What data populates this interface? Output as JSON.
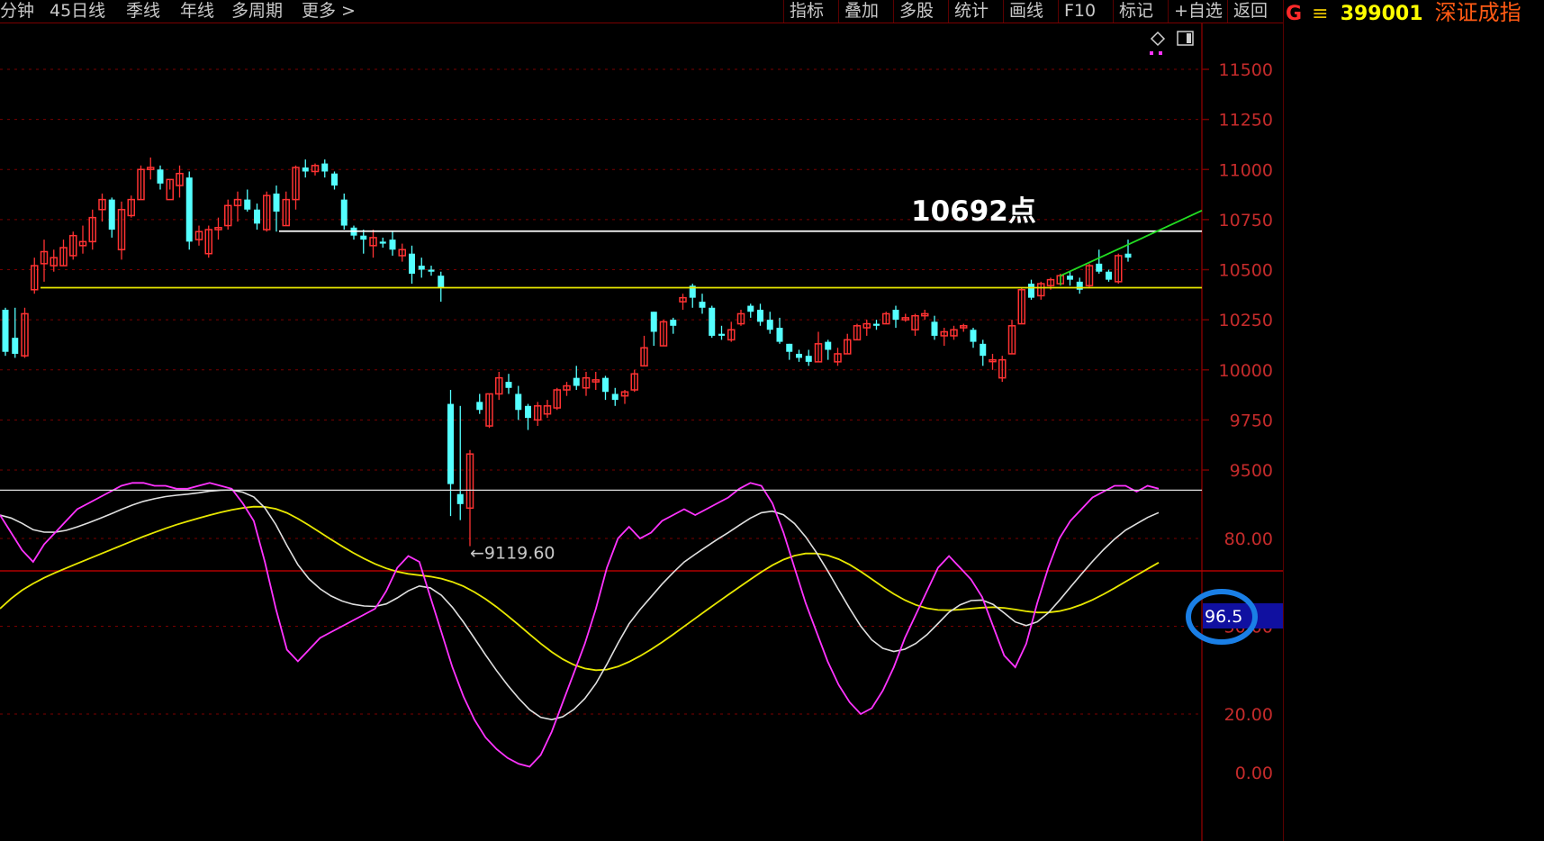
{
  "toolbar": {
    "left_items": [
      "分钟",
      "45日线",
      "季线",
      "年线",
      "多周期",
      "更多 >"
    ],
    "right_items": [
      "指标",
      "叠加",
      "多股",
      "统计",
      "画线",
      "F10",
      "标记",
      "+自选",
      "返回"
    ]
  },
  "stock": {
    "market_flag": "G",
    "menu_glyph": "≡",
    "code": "399001",
    "name": "深证成指"
  },
  "colors": {
    "up": "#ff3232",
    "down": "#54ffff",
    "grid": "#7a0000",
    "axis_text": "#c52b2b",
    "support_line": "#e8e800",
    "resistance_line": "#ffffff",
    "trend_line": "#22dd22",
    "osc_k": "#ff33ff",
    "osc_d": "#e0e0e0",
    "osc_j": "#e8e800",
    "highlight": "#1a7fe6"
  },
  "main_chart": {
    "y_ticks": [
      "11500",
      "11250",
      "11000",
      "10750",
      "10500",
      "10250",
      "10000",
      "9750",
      "9500"
    ],
    "resistance_label": "10692点",
    "low_label": "←9119.60",
    "resistance_value": 10692,
    "support_value": 10410,
    "low_value": 9119.6,
    "candles": [
      [
        10300,
        10310,
        10070,
        10090
      ],
      [
        10160,
        10310,
        10060,
        10080
      ],
      [
        10070,
        10310,
        10060,
        10280
      ],
      [
        10400,
        10560,
        10380,
        10520
      ],
      [
        10530,
        10650,
        10440,
        10590
      ],
      [
        10520,
        10600,
        10490,
        10560
      ],
      [
        10520,
        10650,
        10520,
        10610
      ],
      [
        10570,
        10690,
        10550,
        10670
      ],
      [
        10620,
        10720,
        10580,
        10640
      ],
      [
        10640,
        10800,
        10600,
        10760
      ],
      [
        10800,
        10880,
        10740,
        10850
      ],
      [
        10850,
        10860,
        10660,
        10700
      ],
      [
        10600,
        10840,
        10550,
        10800
      ],
      [
        10770,
        10870,
        10760,
        10850
      ],
      [
        10850,
        11020,
        10850,
        11000
      ],
      [
        11000,
        11060,
        10950,
        11010
      ],
      [
        11000,
        11020,
        10900,
        10930
      ],
      [
        10850,
        10950,
        10900,
        10950
      ],
      [
        10920,
        11020,
        10860,
        10980
      ],
      [
        10960,
        10990,
        10600,
        10640
      ],
      [
        10650,
        10720,
        10620,
        10690
      ],
      [
        10580,
        10720,
        10560,
        10700
      ],
      [
        10700,
        10760,
        10650,
        10710
      ],
      [
        10720,
        10850,
        10700,
        10820
      ],
      [
        10820,
        10890,
        10740,
        10850
      ],
      [
        10850,
        10900,
        10790,
        10800
      ],
      [
        10800,
        10830,
        10700,
        10730
      ],
      [
        10700,
        10890,
        10690,
        10870
      ],
      [
        10880,
        10920,
        10690,
        10790
      ],
      [
        10720,
        10890,
        10720,
        10850
      ],
      [
        10850,
        11020,
        10800,
        11010
      ],
      [
        11010,
        11050,
        10960,
        10990
      ],
      [
        10990,
        11030,
        10970,
        11020
      ],
      [
        11030,
        11050,
        10960,
        10990
      ],
      [
        10980,
        10990,
        10900,
        10920
      ],
      [
        10850,
        10880,
        10700,
        10720
      ],
      [
        10710,
        10720,
        10650,
        10670
      ],
      [
        10670,
        10700,
        10580,
        10650
      ],
      [
        10620,
        10700,
        10560,
        10660
      ],
      [
        10640,
        10660,
        10610,
        10630
      ],
      [
        10650,
        10690,
        10570,
        10600
      ],
      [
        10570,
        10630,
        10540,
        10600
      ],
      [
        10580,
        10620,
        10430,
        10480
      ],
      [
        10520,
        10560,
        10460,
        10500
      ],
      [
        10500,
        10520,
        10470,
        10490
      ],
      [
        10470,
        10490,
        10340,
        10410
      ],
      [
        9830,
        9900,
        9270,
        9430
      ],
      [
        9380,
        9820,
        9250,
        9330
      ],
      [
        9310,
        9600,
        9120,
        9580
      ],
      [
        9840,
        9880,
        9780,
        9800
      ],
      [
        9720,
        9880,
        9710,
        9880
      ],
      [
        9880,
        9990,
        9850,
        9960
      ],
      [
        9940,
        9980,
        9880,
        9910
      ],
      [
        9880,
        9920,
        9750,
        9800
      ],
      [
        9820,
        9830,
        9700,
        9760
      ],
      [
        9750,
        9840,
        9720,
        9820
      ],
      [
        9780,
        9850,
        9760,
        9820
      ],
      [
        9810,
        9910,
        9800,
        9900
      ],
      [
        9900,
        9940,
        9870,
        9920
      ],
      [
        9960,
        10020,
        9900,
        9920
      ],
      [
        9910,
        9990,
        9870,
        9960
      ],
      [
        9940,
        9990,
        9900,
        9950
      ],
      [
        9960,
        9970,
        9850,
        9890
      ],
      [
        9880,
        9910,
        9820,
        9850
      ],
      [
        9870,
        9900,
        9830,
        9890
      ],
      [
        9900,
        10000,
        9890,
        9980
      ],
      [
        10020,
        10170,
        10020,
        10110
      ],
      [
        10290,
        10290,
        10120,
        10190
      ],
      [
        10120,
        10250,
        10120,
        10240
      ],
      [
        10250,
        10260,
        10180,
        10220
      ],
      [
        10340,
        10380,
        10300,
        10360
      ],
      [
        10420,
        10430,
        10310,
        10360
      ],
      [
        10340,
        10380,
        10280,
        10310
      ],
      [
        10310,
        10320,
        10160,
        10170
      ],
      [
        10180,
        10220,
        10150,
        10170
      ],
      [
        10150,
        10240,
        10140,
        10200
      ],
      [
        10230,
        10300,
        10220,
        10280
      ],
      [
        10320,
        10330,
        10260,
        10290
      ],
      [
        10300,
        10330,
        10220,
        10240
      ],
      [
        10250,
        10290,
        10180,
        10200
      ],
      [
        10210,
        10260,
        10130,
        10140
      ],
      [
        10130,
        10130,
        10050,
        10090
      ],
      [
        10080,
        10100,
        10040,
        10060
      ],
      [
        10070,
        10100,
        10020,
        10040
      ],
      [
        10040,
        10190,
        10040,
        10130
      ],
      [
        10140,
        10150,
        10050,
        10100
      ],
      [
        10040,
        10110,
        10020,
        10080
      ],
      [
        10080,
        10180,
        10080,
        10150
      ],
      [
        10150,
        10230,
        10150,
        10220
      ],
      [
        10210,
        10250,
        10170,
        10230
      ],
      [
        10230,
        10250,
        10200,
        10220
      ],
      [
        10230,
        10290,
        10230,
        10280
      ],
      [
        10300,
        10320,
        10210,
        10250
      ],
      [
        10250,
        10280,
        10240,
        10260
      ],
      [
        10200,
        10280,
        10170,
        10270
      ],
      [
        10270,
        10300,
        10250,
        10280
      ],
      [
        10240,
        10270,
        10150,
        10170
      ],
      [
        10170,
        10210,
        10120,
        10190
      ],
      [
        10170,
        10220,
        10150,
        10200
      ],
      [
        10210,
        10230,
        10190,
        10220
      ],
      [
        10200,
        10210,
        10110,
        10140
      ],
      [
        10130,
        10150,
        10020,
        10070
      ],
      [
        10050,
        10080,
        10000,
        10050
      ],
      [
        9960,
        10070,
        9940,
        10050
      ],
      [
        10080,
        10250,
        10080,
        10220
      ],
      [
        10230,
        10410,
        10230,
        10400
      ],
      [
        10430,
        10450,
        10350,
        10360
      ],
      [
        10370,
        10440,
        10350,
        10430
      ],
      [
        10420,
        10460,
        10400,
        10450
      ],
      [
        10430,
        10480,
        10430,
        10470
      ],
      [
        10470,
        10490,
        10420,
        10450
      ],
      [
        10440,
        10460,
        10380,
        10400
      ],
      [
        10420,
        10530,
        10410,
        10520
      ],
      [
        10530,
        10600,
        10480,
        10490
      ],
      [
        10490,
        10500,
        10440,
        10450
      ],
      [
        10440,
        10580,
        10430,
        10570
      ],
      [
        10580,
        10650,
        10540,
        10560
      ]
    ]
  },
  "oscillator": {
    "y_ticks": [
      "80.00",
      "50.00",
      "20.00",
      "0.00"
    ],
    "current_value": "96.5",
    "k": [
      88,
      82,
      76,
      72,
      78,
      82,
      86,
      90,
      92,
      94,
      96,
      98,
      99,
      99,
      98,
      98,
      97,
      97,
      98,
      99,
      98,
      97,
      92,
      86,
      72,
      56,
      42,
      38,
      42,
      46,
      48,
      50,
      52,
      54,
      56,
      62,
      70,
      74,
      72,
      60,
      48,
      36,
      26,
      18,
      12,
      8,
      5,
      3,
      2,
      6,
      14,
      24,
      34,
      44,
      56,
      70,
      80,
      84,
      80,
      82,
      86,
      88,
      90,
      88,
      90,
      92,
      94,
      97,
      99,
      98,
      92,
      82,
      70,
      58,
      48,
      38,
      30,
      24,
      20,
      22,
      28,
      36,
      46,
      54,
      62,
      70,
      74,
      70,
      66,
      60,
      50,
      40,
      36,
      44,
      58,
      70,
      80,
      86,
      90,
      94,
      96,
      98,
      98,
      96,
      98,
      97
    ]
  }
}
